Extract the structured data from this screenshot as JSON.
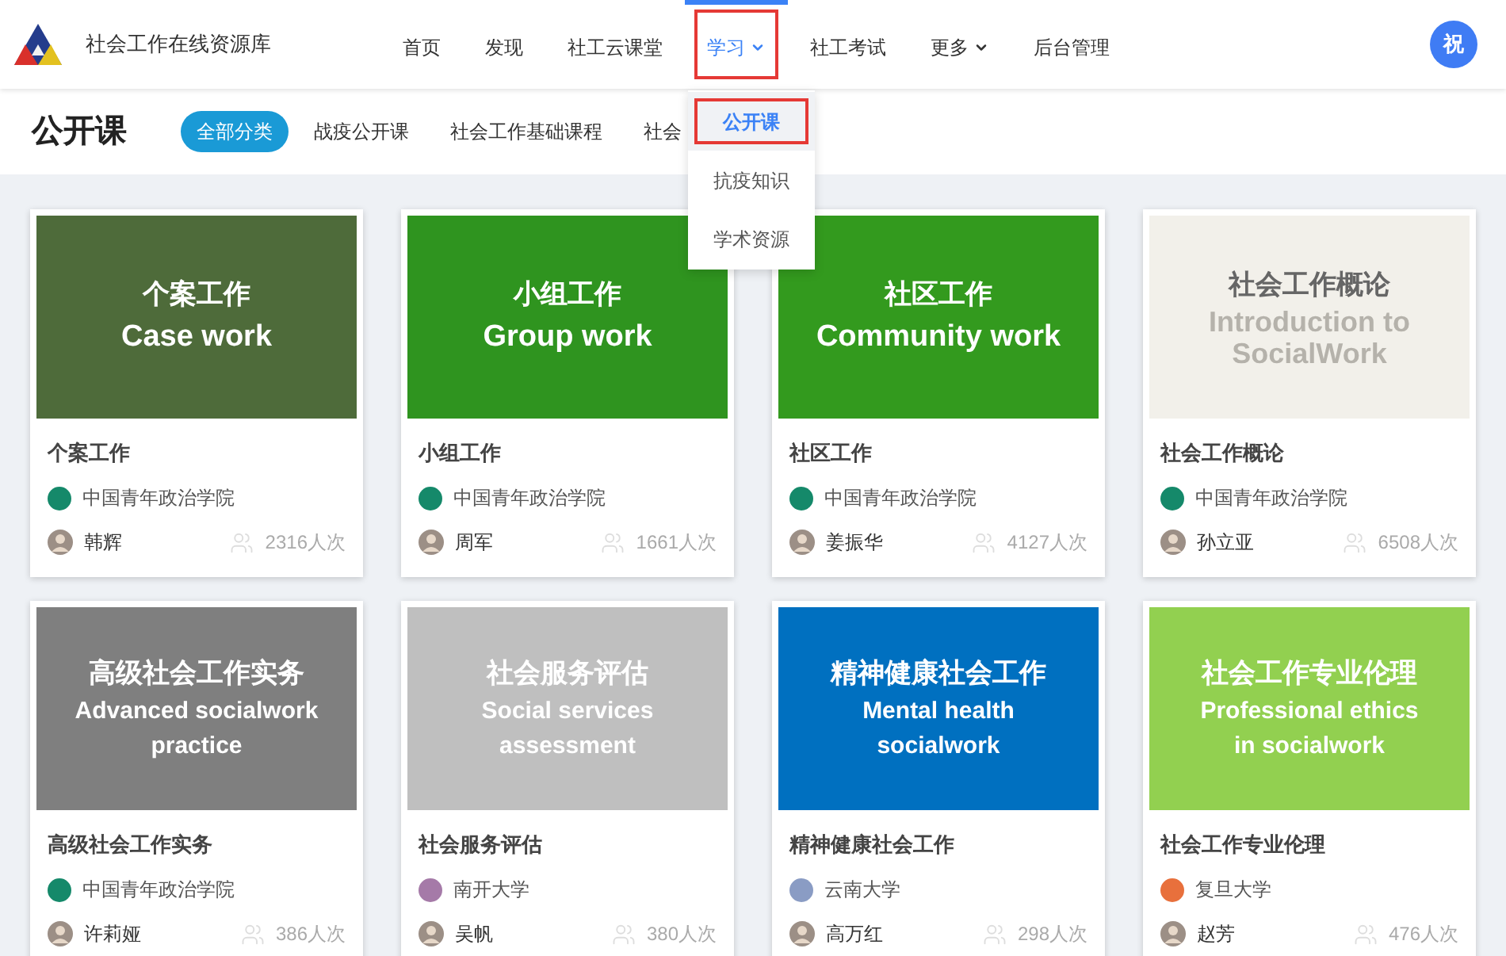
{
  "site": {
    "title": "社会工作在线资源库"
  },
  "nav": [
    {
      "label": "首页",
      "selected": false,
      "dropdown": false,
      "highlighted": false
    },
    {
      "label": "发现",
      "selected": false,
      "dropdown": false,
      "highlighted": false
    },
    {
      "label": "社工云课堂",
      "selected": false,
      "dropdown": false,
      "highlighted": false
    },
    {
      "label": "学习",
      "selected": true,
      "dropdown": true,
      "highlighted": true
    },
    {
      "label": "社工考试",
      "selected": false,
      "dropdown": false,
      "highlighted": false
    },
    {
      "label": "更多",
      "selected": false,
      "dropdown": true,
      "highlighted": false
    },
    {
      "label": "后台管理",
      "selected": false,
      "dropdown": false,
      "highlighted": false
    }
  ],
  "user": {
    "avatar": "祝"
  },
  "menu": [
    {
      "label": "公开课",
      "selected": true,
      "highlighted": true
    },
    {
      "label": "抗疫知识",
      "selected": false,
      "highlighted": false
    },
    {
      "label": "学术资源",
      "selected": false,
      "highlighted": false
    }
  ],
  "page": {
    "title": "公开课"
  },
  "categories": [
    {
      "label": "全部分类",
      "selected": true
    },
    {
      "label": "战疫公开课",
      "selected": false
    },
    {
      "label": "社会工作基础课程",
      "selected": false
    },
    {
      "label": "社会",
      "selected": false
    }
  ],
  "courses": [
    {
      "cover": {
        "color": "#4e6b3a",
        "kind": "dark",
        "title": "个案工作",
        "subtitle": [
          "Case work"
        ]
      },
      "title": "个案工作",
      "school": {
        "name": "中国青年政治学院",
        "color": "#15896a"
      },
      "teacher": "韩辉",
      "views": "2316人次"
    },
    {
      "cover": {
        "color": "#2f941f",
        "kind": "dark",
        "title": "小组工作",
        "subtitle": [
          "Group work"
        ]
      },
      "title": "小组工作",
      "school": {
        "name": "中国青年政治学院",
        "color": "#15896a"
      },
      "teacher": "周军",
      "views": "1661人次"
    },
    {
      "cover": {
        "color": "#339a1e",
        "kind": "dark",
        "title": "社区工作",
        "subtitle": [
          "Community work"
        ]
      },
      "title": "社区工作",
      "school": {
        "name": "中国青年政治学院",
        "color": "#15896a"
      },
      "teacher": "姜振华",
      "views": "4127人次"
    },
    {
      "cover": {
        "color": "#f2f0ea",
        "kind": "light",
        "title": "社会工作概论",
        "subtitle": [
          "Introduction to",
          "SocialWork"
        ]
      },
      "title": "社会工作概论",
      "school": {
        "name": "中国青年政治学院",
        "color": "#15896a"
      },
      "teacher": "孙立亚",
      "views": "6508人次"
    },
    {
      "cover": {
        "color": "#7f7f7f",
        "kind": "dark",
        "title": "高级社会工作实务",
        "subtitle": [
          "Advanced socialwork",
          "practice"
        ]
      },
      "title": "高级社会工作实务",
      "school": {
        "name": "中国青年政治学院",
        "color": "#15896a"
      },
      "teacher": "许莉娅",
      "views": "386人次"
    },
    {
      "cover": {
        "color": "#bfbfbf",
        "kind": "dark",
        "title": "社会服务评估",
        "subtitle": [
          "Social services",
          "assessment"
        ]
      },
      "title": "社会服务评估",
      "school": {
        "name": "南开大学",
        "color": "#a57aa8"
      },
      "teacher": "吴帆",
      "views": "380人次"
    },
    {
      "cover": {
        "color": "#0070c0",
        "kind": "dark",
        "title": "精神健康社会工作",
        "subtitle": [
          "Mental health",
          "socialwork"
        ]
      },
      "title": "精神健康社会工作",
      "school": {
        "name": "云南大学",
        "color": "#8a9cc4"
      },
      "teacher": "高万红",
      "views": "298人次"
    },
    {
      "cover": {
        "color": "#92d050",
        "kind": "dark",
        "title": "社会工作专业伦理",
        "subtitle": [
          "Professional ethics",
          "in socialwork"
        ]
      },
      "title": "社会工作专业伦理",
      "school": {
        "name": "复旦大学",
        "color": "#e8703c"
      },
      "teacher": "赵芳",
      "views": "476人次"
    }
  ]
}
